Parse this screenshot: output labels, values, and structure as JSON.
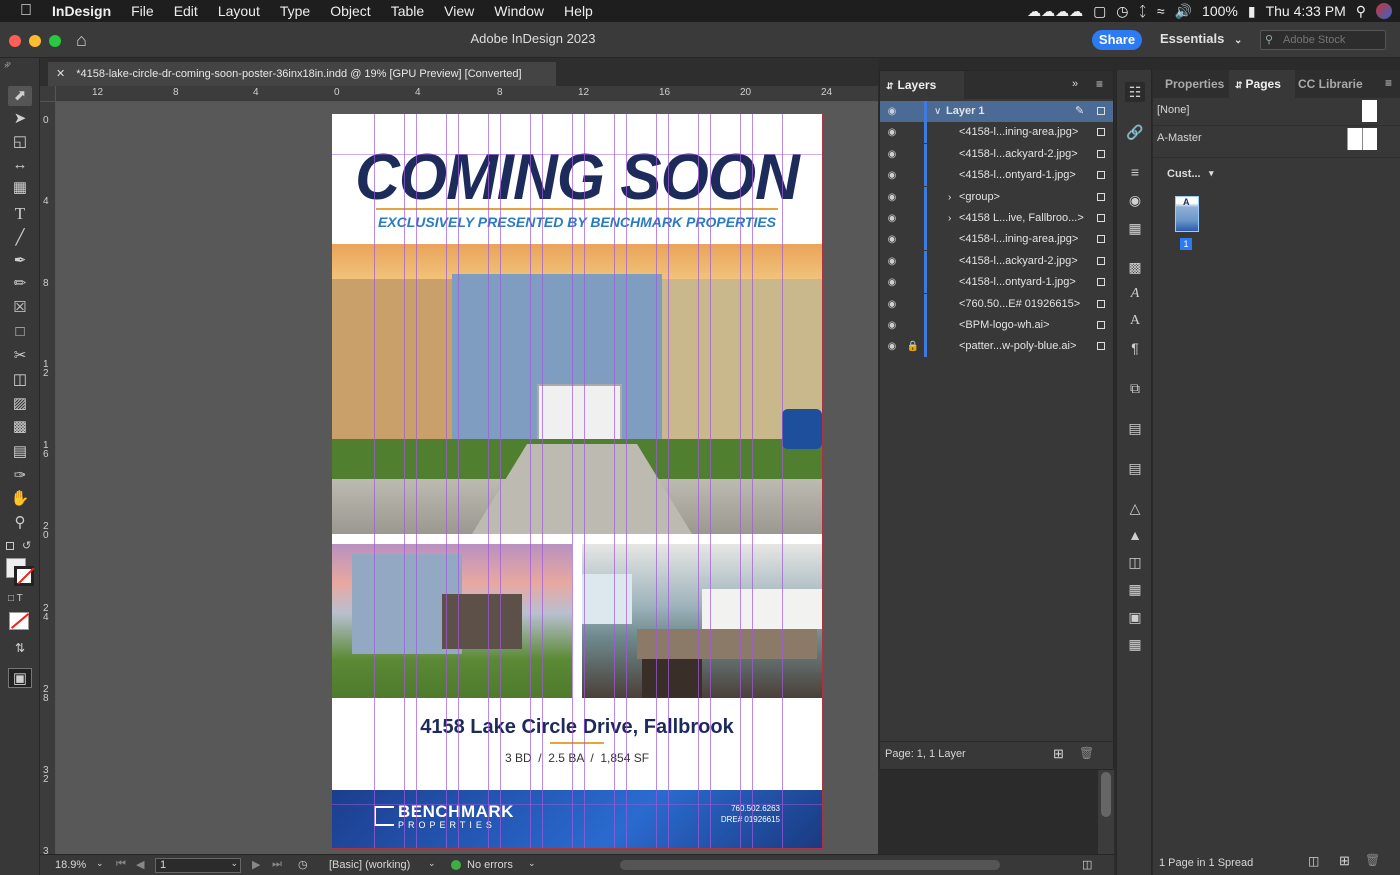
{
  "menubar": {
    "app": "InDesign",
    "items": [
      "File",
      "Edit",
      "Layout",
      "Type",
      "Object",
      "Table",
      "View",
      "Window",
      "Help"
    ],
    "battery": "100%",
    "clock": "Thu 4:33 PM"
  },
  "titlebar": {
    "title": "Adobe InDesign 2023",
    "share": "Share",
    "workspace": "Essentials",
    "stock_placeholder": "Adobe Stock"
  },
  "tab": {
    "label": "*4158-lake-circle-dr-coming-soon-poster-36inx18in.indd @ 19% [GPU Preview] [Converted]"
  },
  "rulers": {
    "h": [
      "12",
      "8",
      "4",
      "0",
      "4",
      "8",
      "12",
      "16",
      "20",
      "24"
    ],
    "v": [
      "0",
      "4",
      "8",
      "1\n2",
      "1\n6",
      "2\n0",
      "2\n4",
      "2\n8",
      "3\n2",
      "3"
    ]
  },
  "poster": {
    "headline": "COMING SOON",
    "subhead": "EXCLUSIVELY PRESENTED BY BENCHMARK PROPERTIES",
    "address": "4158 Lake Circle Drive, Fallbrook",
    "specs": "3 BD  /  2.5 BA  /  1,854 SF",
    "brand": "BENCHMARK",
    "brand_sub": "PROPERTIES",
    "phone": "760.502.6263",
    "dre": "DRE# 01926615"
  },
  "status": {
    "zoom": "18.9%",
    "page": "1",
    "style": "[Basic] (working)",
    "errors": "No errors"
  },
  "layers": {
    "tab": "Layers",
    "rows": [
      {
        "name": "Layer 1",
        "top": true
      },
      {
        "name": "<4158-l...ining-area.jpg>"
      },
      {
        "name": "<4158-l...ackyard-2.jpg>"
      },
      {
        "name": "<4158-l...ontyard-1.jpg>"
      },
      {
        "name": "<group>",
        "expand": true
      },
      {
        "name": "<4158 L...ive, Fallbroo...>",
        "expand": true
      },
      {
        "name": "<4158-l...ining-area.jpg>"
      },
      {
        "name": "<4158-l...ackyard-2.jpg>"
      },
      {
        "name": "<4158-l...ontyard-1.jpg>"
      },
      {
        "name": "<760.50...E# 01926615>"
      },
      {
        "name": "<BPM-logo-wh.ai>"
      },
      {
        "name": "<patter...w-poly-blue.ai>",
        "locked": true
      }
    ],
    "footer": "Page: 1, 1 Layer"
  },
  "pages": {
    "tabs": [
      "Properties",
      "Pages",
      "CC Librarie"
    ],
    "none": "[None]",
    "master": "A-Master",
    "custom": "Cust...",
    "thumb_letter": "A",
    "page_number": "1",
    "footer": "1 Page in 1 Spread"
  }
}
